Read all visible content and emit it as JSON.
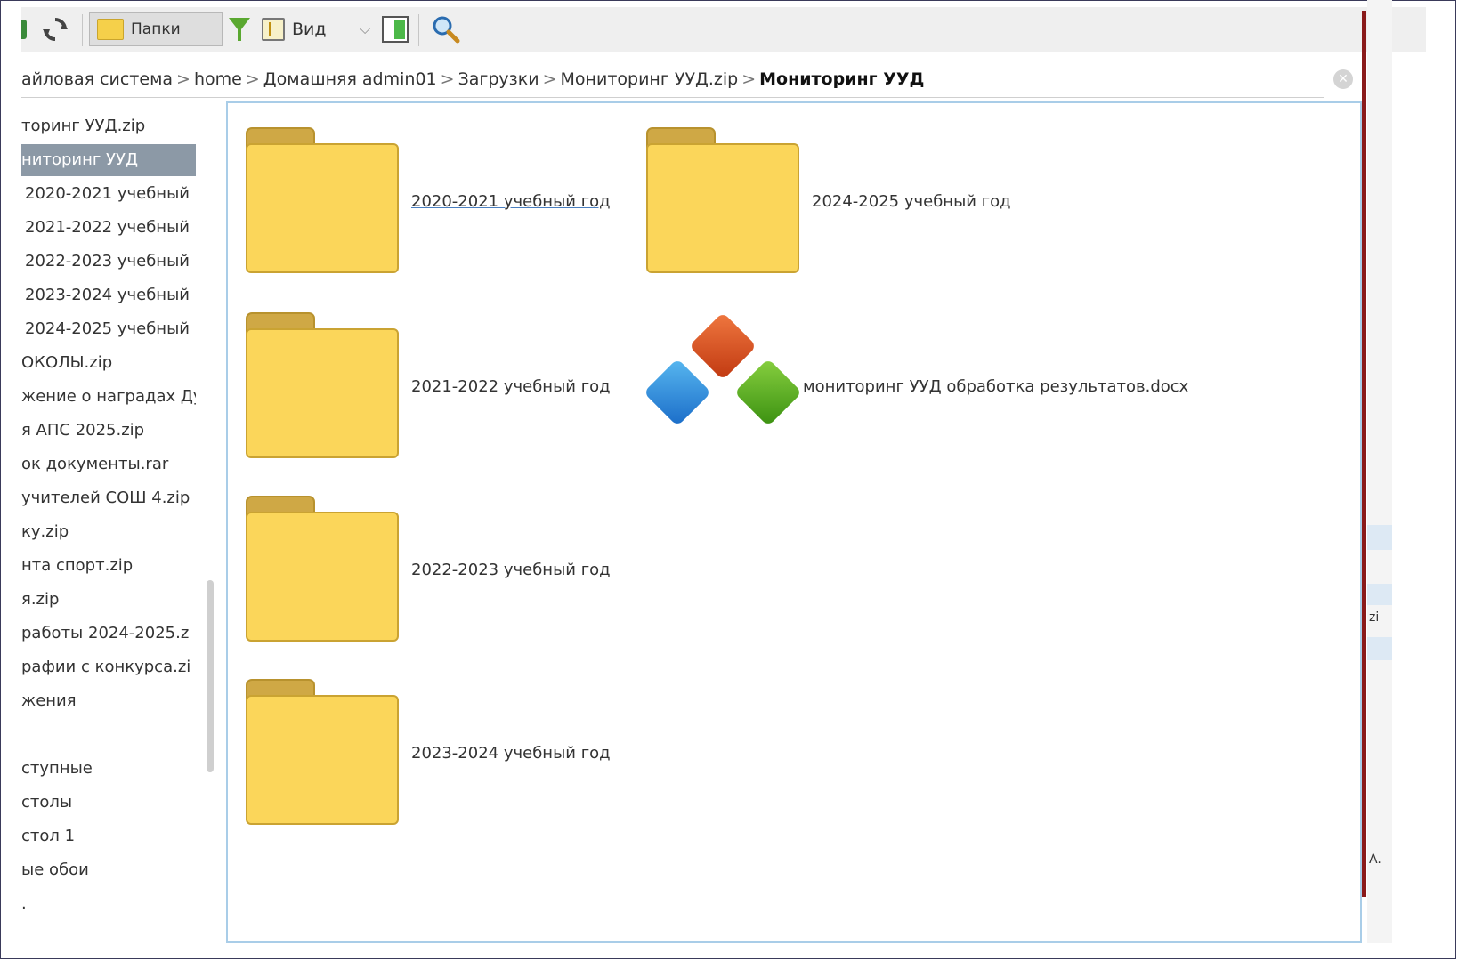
{
  "toolbar": {
    "folders_label": "Папки",
    "view_label": "Вид"
  },
  "path": {
    "crumbs": [
      "айловая система",
      "home",
      "Домашняя admin01",
      "Загрузки",
      "Мониторинг УУД.zip",
      "Мониторинг УУД"
    ],
    "separator": ">"
  },
  "sidebar": {
    "items": [
      "торинг УУД.zip",
      "ниторинг УУД",
      "2020-2021 учебный",
      "2021-2022 учебный",
      "2022-2023 учебный",
      "2023-2024 учебный",
      "2024-2025 учебный",
      "ОКОЛЫ.zip",
      "жение о наградах Ду",
      "я АПС 2025.zip",
      "ок документы.rar",
      "учителей СОШ 4.zip",
      "ку.zip",
      "нта спорт.zip",
      "я.zip",
      "работы 2024-2025.z",
      "рафии с конкурса.zi",
      "жения",
      "",
      "ступные",
      "столы",
      "стол 1",
      "ые обои",
      "."
    ],
    "selected_index": 1
  },
  "main": {
    "items": [
      {
        "type": "folder",
        "label": "2020-2021 учебный год"
      },
      {
        "type": "folder",
        "label": "2024-2025 учебный год"
      },
      {
        "type": "folder",
        "label": "2021-2022 учебный год"
      },
      {
        "type": "document",
        "label": "мониторинг УУД обработка результатов.docx"
      },
      {
        "type": "folder",
        "label": "2022-2023 учебный год"
      },
      {
        "type": "folder",
        "label": "2023-2024 учебный год"
      }
    ]
  },
  "right_strip": {
    "texts": [
      "zi",
      "A."
    ]
  },
  "colors": {
    "selection": "#8c99a6",
    "folder_fill": "#fbd65a",
    "main_border": "#a9cde8",
    "window_edge": "#8a1a1a"
  }
}
